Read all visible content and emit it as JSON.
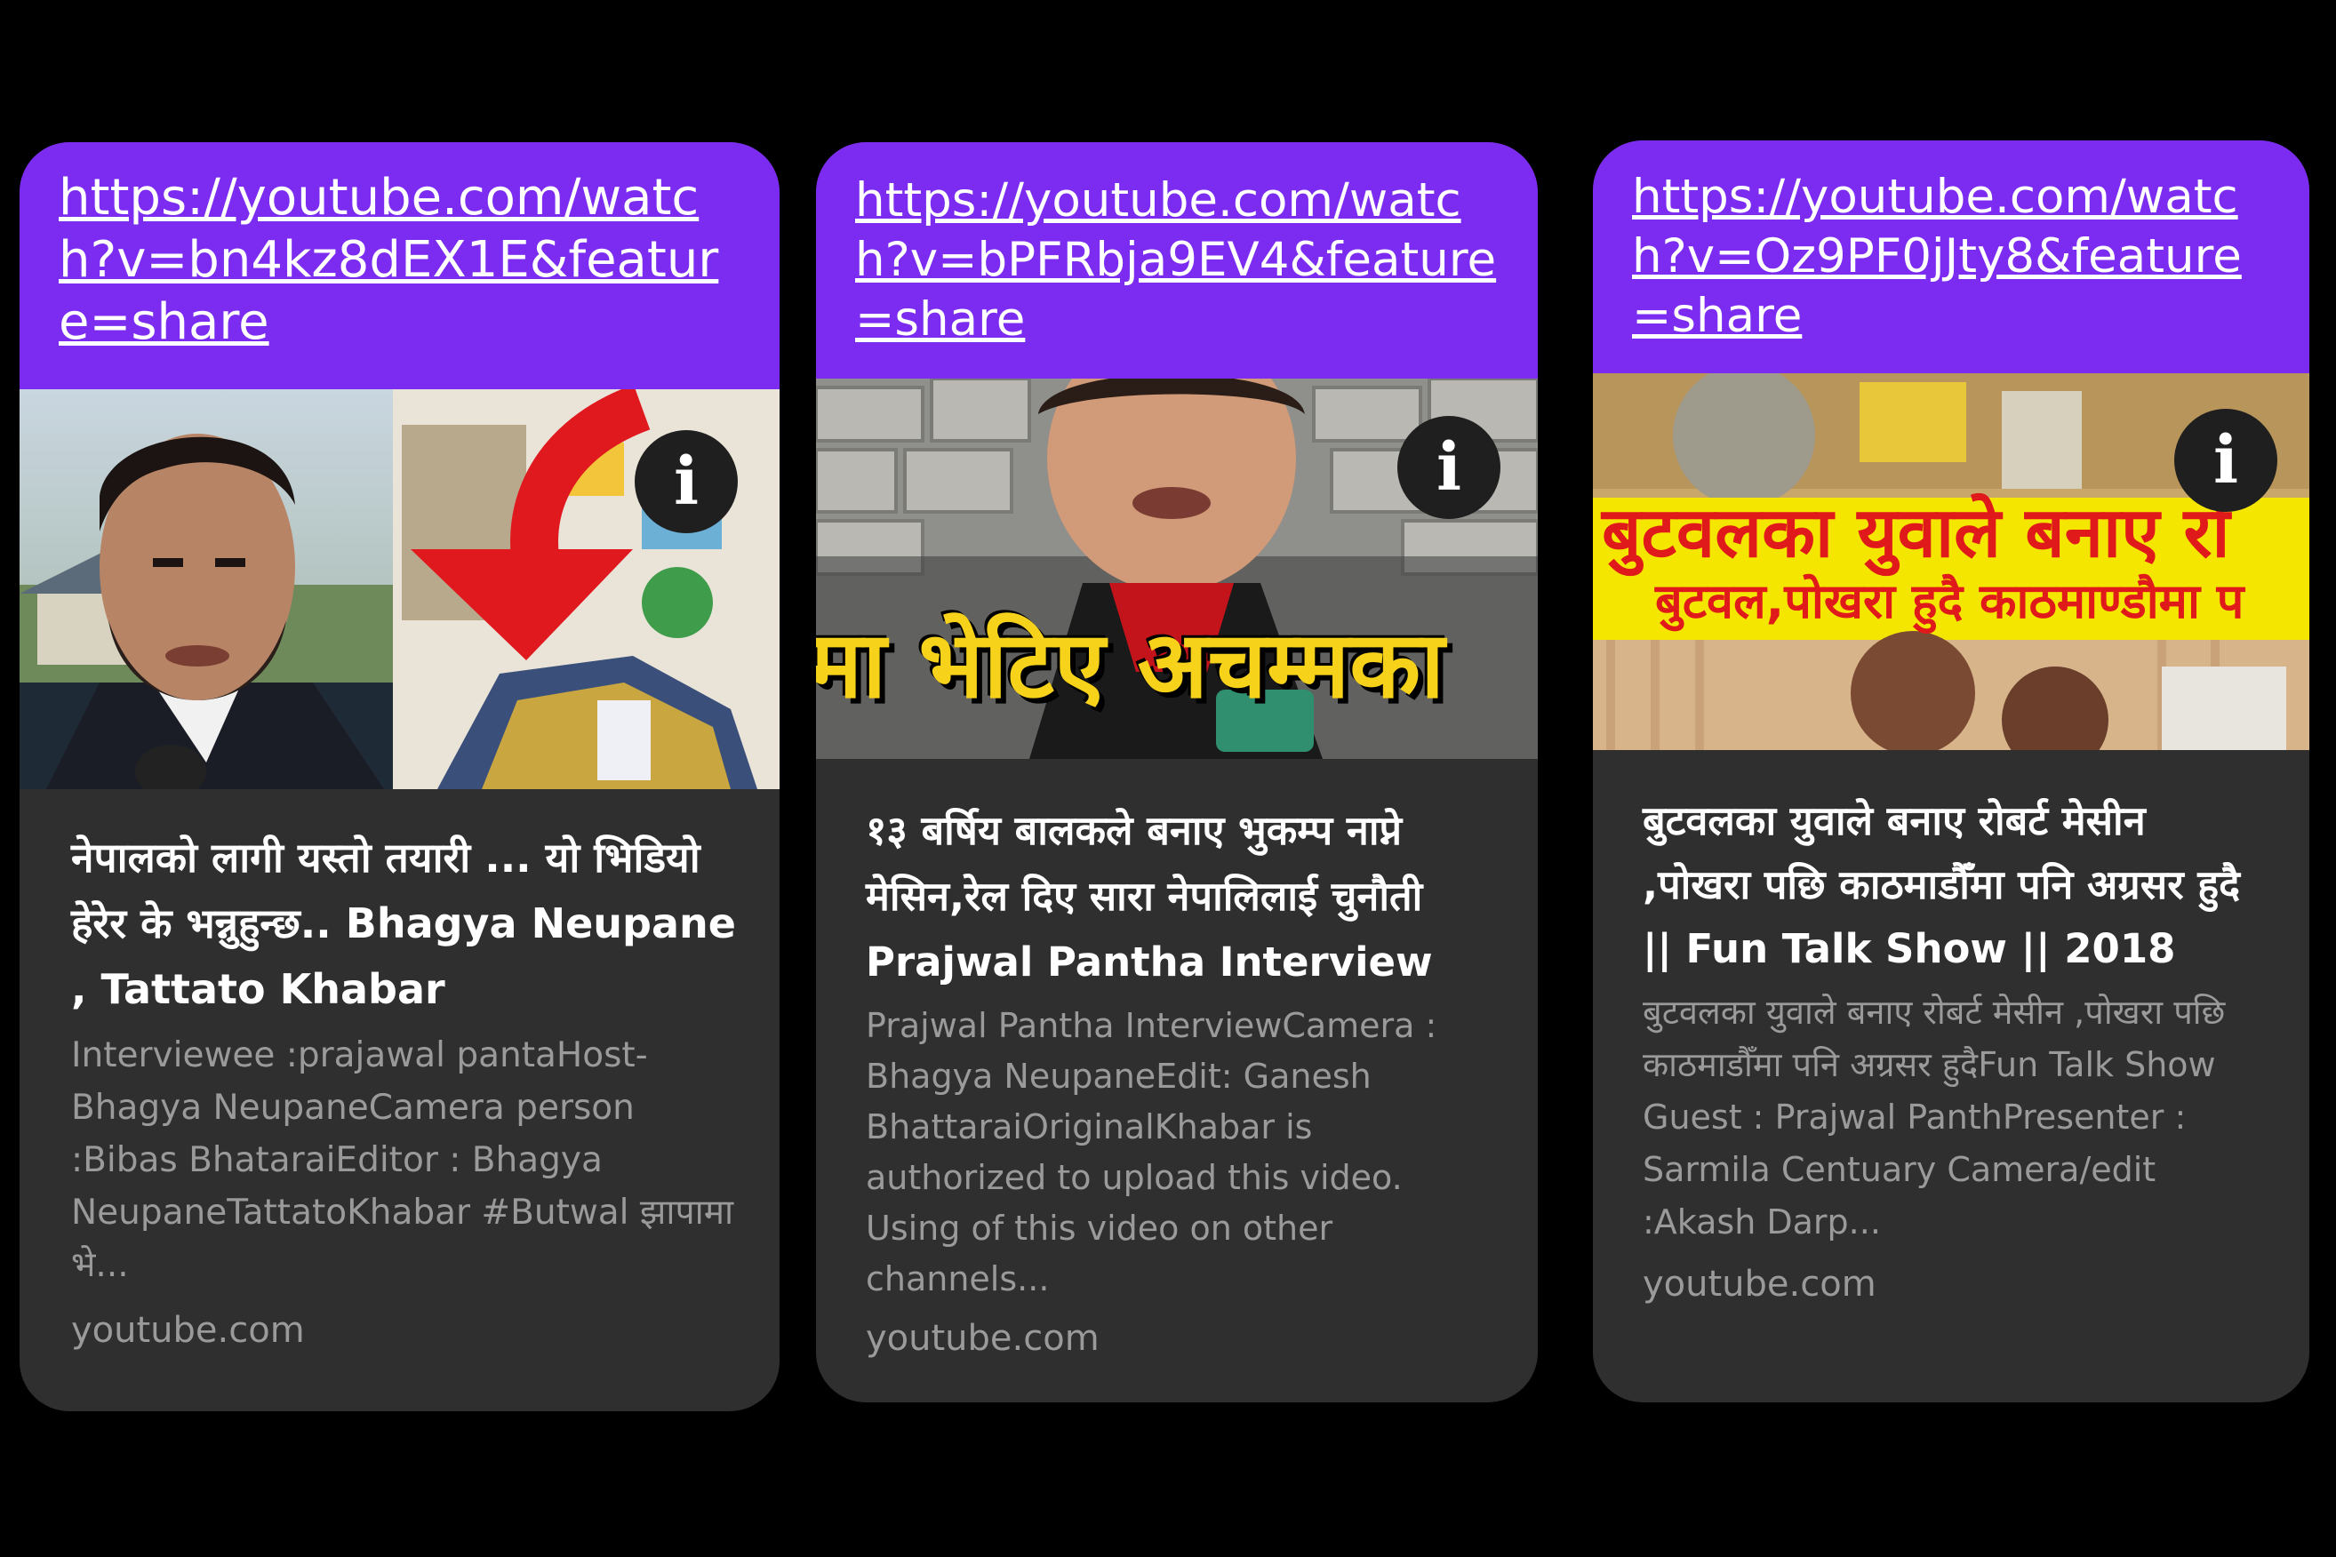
{
  "cards": [
    {
      "url": "https://youtube.com/watch?v=bn4kz8dEX1E&feature=share",
      "title": "नेपालको लागी यस्तो तयारी ... यो भिडियो हेरेर के भन्नुहुन्छ.. Bhagya Neupane , Tattato Khabar",
      "description": "Interviewee :prajawal pantaHost-Bhagya NeupaneCamera person :Bibas BhataraiEditor : Bhagya NeupaneTattatoKhabar #Butwal झापामा भे...",
      "domain": "youtube.com",
      "info_icon": "i"
    },
    {
      "url": "https://youtube.com/watch?v=bPFRbja9EV4&feature=share",
      "thumb_banner": "मा भेटिए अचम्मका",
      "title": "१३ बर्षिय बालकले बनाए भुकम्प नाप्ने मेसिन,रेल दिए सारा नेपालिलाई चुनौती Prajwal Pantha Interview",
      "description": "Prajwal Pantha InterviewCamera : Bhagya NeupaneEdit: Ganesh BhattaraiOriginalKhabar is authorized to upload this video. Using of this video on other channels...",
      "domain": "youtube.com",
      "info_icon": "i"
    },
    {
      "url": "https://youtube.com/watch?v=Oz9PF0jJty8&feature=share",
      "thumb_banner_1": "बुटवलका युवाले बनाए रो",
      "thumb_banner_2": "बुटवल,पोखरा हुदै काठमाण्डौमा प",
      "title": "बुटवलका युवाले बनाए रोबर्ट मेसीन ,पोखरा पछि काठमाडौँमा पनि अग्रसर हुदै || Fun Talk Show || 2018",
      "description": "बुटवलका युवाले बनाए रोबर्ट मेसीन ,पोखरा पछि काठमाडौँमा पनि अग्रसर हुदैFun Talk Show Guest : Prajwal PanthPresenter : Sarmila Centuary Camera/edit :Akash Darp...",
      "domain": "youtube.com",
      "info_icon": "i"
    }
  ],
  "colors": {
    "link_bar": "#7b2cf0",
    "card_bg": "#2f2f2f",
    "background": "#000000",
    "banner_yellow": "#f5e600",
    "banner_red": "#e01a1a"
  }
}
